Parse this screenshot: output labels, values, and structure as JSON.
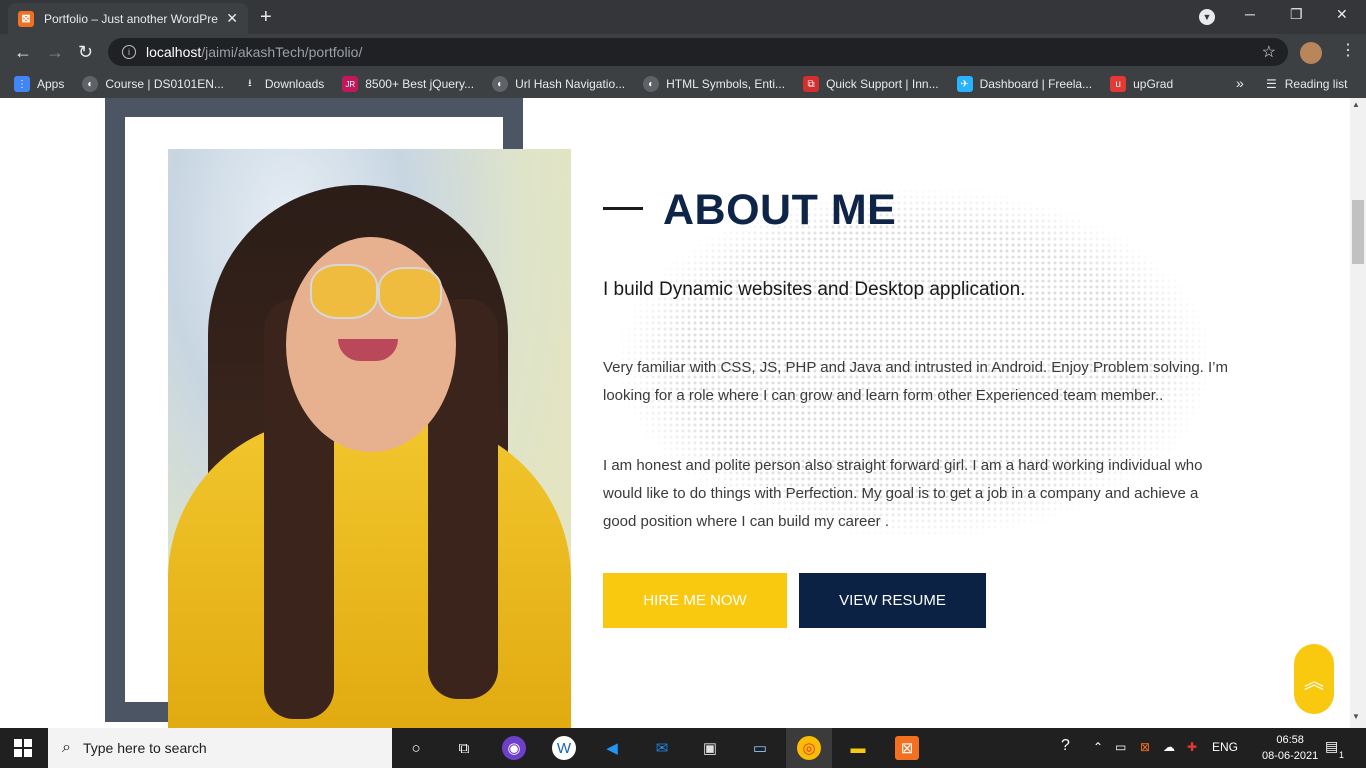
{
  "browser": {
    "tab_title": "Portfolio – Just another WordPre",
    "tab_close": "✕",
    "new_tab": "+",
    "url_host": "localhost",
    "url_path": "/jaimi/akashTech/portfolio/",
    "window_controls": {
      "minimize": "─",
      "maximize": "❐",
      "close": "✕"
    }
  },
  "bookmarks": [
    {
      "label": "Apps",
      "icon": "apps-grid-icon",
      "color": "#4285f4"
    },
    {
      "label": "Course | DS0101EN...",
      "icon": "globe-icon",
      "color": "#5f6368"
    },
    {
      "label": "Downloads",
      "icon": "download-icon",
      "color": "#5f6368"
    },
    {
      "label": "8500+ Best jQuery...",
      "icon": "jr-icon",
      "color": "#c2185b"
    },
    {
      "label": "Url Hash Navigatio...",
      "icon": "globe-icon",
      "color": "#5f6368"
    },
    {
      "label": "HTML Symbols, Enti...",
      "icon": "globe-icon",
      "color": "#5f6368"
    },
    {
      "label": "Quick Support | Inn...",
      "icon": "support-icon",
      "color": "#d32f2f"
    },
    {
      "label": "Dashboard | Freela...",
      "icon": "freelancer-icon",
      "color": "#29b2fe"
    },
    {
      "label": "upGrad",
      "icon": "upgrad-icon",
      "color": "#e53935"
    }
  ],
  "reading_list": "Reading list",
  "about": {
    "title": "ABOUT ME",
    "subtitle": "I build Dynamic websites and Desktop application.",
    "para1": "Very familiar with CSS, JS, PHP and Java and intrusted in Android. Enjoy Problem solving. I’m looking for a role where I can grow and learn form other Experienced team member..",
    "para2": "I am honest and polite person also straight forward girl. I am a hard working individual who would like to do things with Perfection. My goal is to get a job in a company and achieve a good position where I can build my career .",
    "hire_button": "HIRE ME NOW",
    "resume_button": "VIEW RESUME"
  },
  "colors": {
    "navy": "#0c2244",
    "yellow": "#f9c90f",
    "frame": "#4b5563"
  },
  "taskbar": {
    "search_placeholder": "Type here to search",
    "lang": "ENG",
    "time": "06:58",
    "date": "08-06-2021",
    "notifications": "1"
  }
}
